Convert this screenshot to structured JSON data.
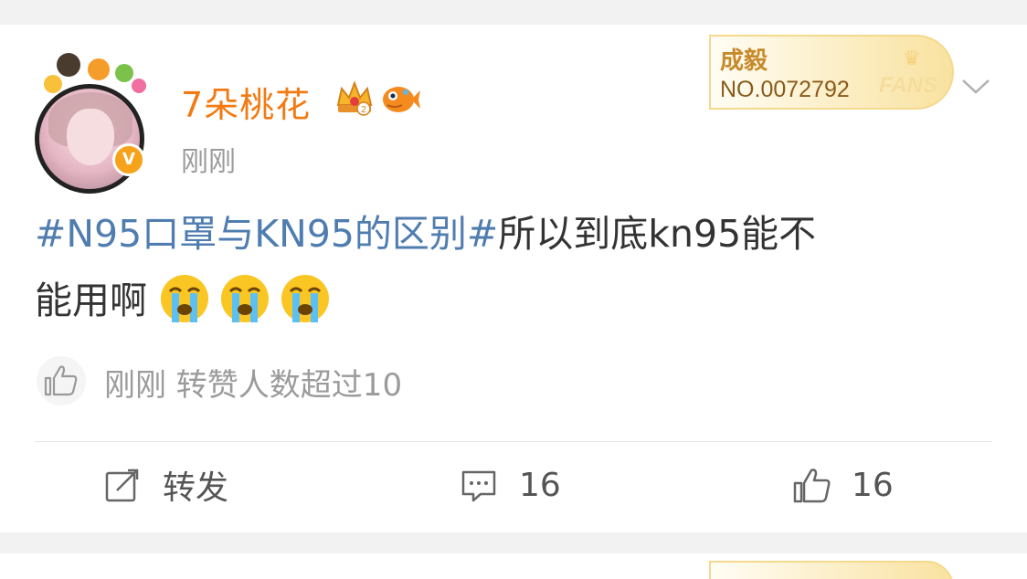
{
  "post": {
    "username": "7朵桃花",
    "time": "刚刚",
    "verified_mark": "V",
    "fans_card": {
      "name": "成毅",
      "number": "NO.0072792",
      "label": "FANS"
    },
    "content": {
      "topic": "#N95口罩与KN95的区别#",
      "text_line1": "所以到底kn95能不",
      "text_line2": "能用啊"
    },
    "like_notice": "刚刚 转赞人数超过10",
    "actions": {
      "repost_label": "转发",
      "comment_count": "16",
      "like_count": "16"
    }
  },
  "colors": {
    "username": "#f37a12",
    "topic": "#507daf",
    "text": "#333333",
    "muted": "#9b9b9b",
    "background": "#f2f2f2",
    "verified": "#f7a21b"
  },
  "icons": [
    "crown-badge-icon",
    "fish-badge-icon",
    "chevron-down-icon",
    "thumbs-up-icon",
    "repost-icon",
    "comment-icon",
    "crying-emoji-icon"
  ]
}
